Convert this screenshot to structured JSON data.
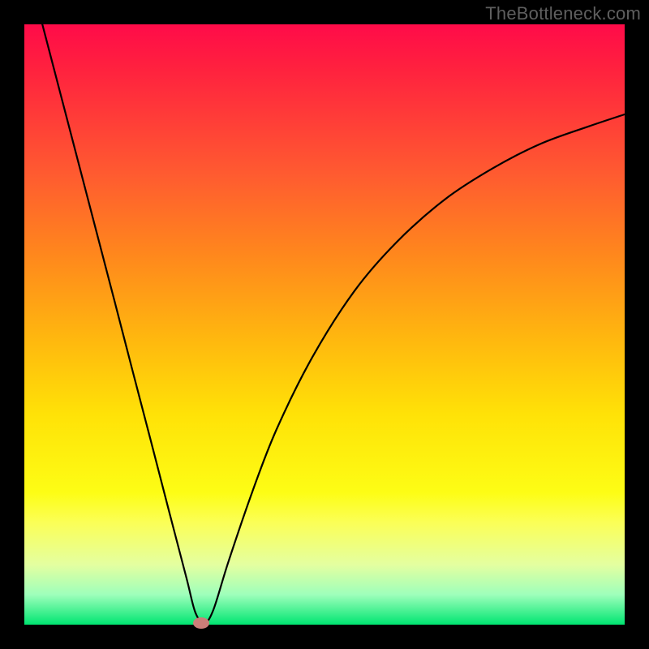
{
  "watermark": "TheBottleneck.com",
  "chart_data": {
    "type": "line",
    "title": "",
    "xlabel": "",
    "ylabel": "",
    "xlim": [
      0,
      100
    ],
    "ylim": [
      0,
      100
    ],
    "grid": false,
    "legend": false,
    "background": "red-yellow-green vertical gradient",
    "series": [
      {
        "name": "curve",
        "color": "#000000",
        "x": [
          3,
          6,
          9,
          12,
          15,
          18,
          21,
          24,
          27,
          28.5,
          30,
          31.5,
          34,
          38,
          42,
          48,
          55,
          62,
          70,
          78,
          86,
          94,
          100
        ],
        "y": [
          100,
          88.5,
          77,
          65.5,
          54,
          42.4,
          30.9,
          19.3,
          7.8,
          2.0,
          0.3,
          2.5,
          10.5,
          22.2,
          32.5,
          44.6,
          55.6,
          63.7,
          70.8,
          76.0,
          80.1,
          83.0,
          85.0
        ]
      }
    ],
    "marker": {
      "x": 29.5,
      "y": 0.3,
      "shape": "ellipse",
      "color": "#cb7e79"
    }
  }
}
